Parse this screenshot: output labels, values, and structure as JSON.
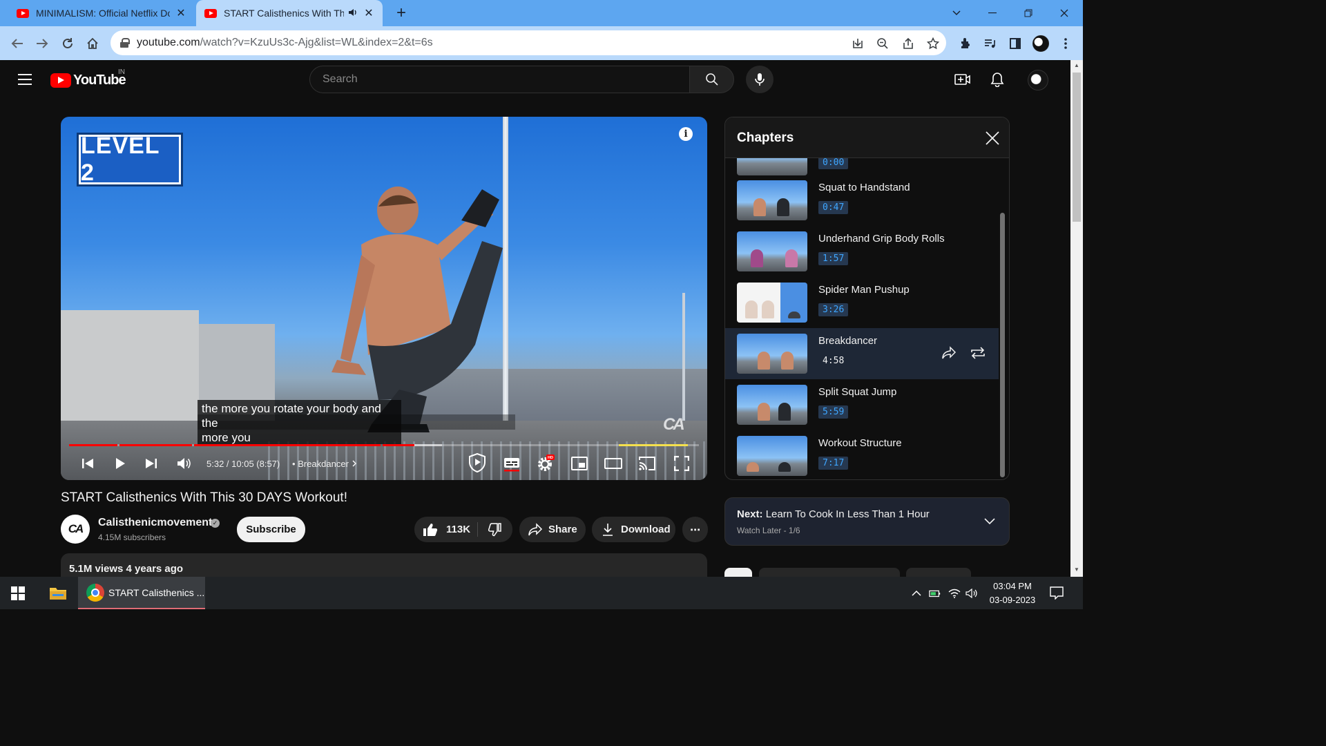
{
  "browser": {
    "tabs": [
      {
        "title": "MINIMALISM: Official Netflix Do",
        "close": "✕"
      },
      {
        "title": "START Calisthenics With This",
        "close": "✕"
      }
    ],
    "new_tab": "+",
    "url_domain": "youtube.com",
    "url_path": "/watch?v=KzuUs3c-Ajg&list=WL&index=2&t=6s"
  },
  "youtube": {
    "logo_text": "YouTube",
    "country_code": "IN",
    "search_placeholder": "Search"
  },
  "player": {
    "overlay_badge": "LEVEL 2",
    "caption_line1": "the more you rotate your body and the",
    "caption_line2": "more you",
    "watermark": "CA",
    "time_display": "5:32 / 10:05 (8:57)",
    "separator": "•",
    "chapter_name": "Breakdancer",
    "progress_fraction": 0.55,
    "hd_badge": "HD"
  },
  "chapters": {
    "heading": "Chapters",
    "partial_time": "0:00",
    "items": [
      {
        "title": "Squat to Handstand",
        "time": "0:47",
        "active": false
      },
      {
        "title": "Underhand Grip Body Rolls",
        "time": "1:57",
        "active": false
      },
      {
        "title": "Spider Man Pushup",
        "time": "3:26",
        "active": false
      },
      {
        "title": "Breakdancer",
        "time": "4:58",
        "active": true
      },
      {
        "title": "Split Squat Jump",
        "time": "5:59",
        "active": false
      },
      {
        "title": "Workout Structure",
        "time": "7:17",
        "active": false
      }
    ]
  },
  "video": {
    "title": "START Calisthenics With This 30 DAYS Workout!",
    "channel_avatar_text": "CA",
    "channel_name": "Calisthenicmovement",
    "verified_mark": "✓",
    "subscribers": "4.15M subscribers",
    "subscribe_label": "Subscribe",
    "likes": "113K",
    "share_label": "Share",
    "download_label": "Download",
    "more_label": "⋯",
    "stats": "5.1M views  4 years ago"
  },
  "next_up": {
    "label": "Next:",
    "title": "Learn To Cook In Less Than 1 Hour",
    "playlist": "Watch Later - 1/6"
  },
  "taskbar": {
    "chrome_window_title": "START Calisthenics ...",
    "time": "03:04 PM",
    "date": "03-09-2023"
  },
  "colors": {
    "youtube_red": "#ff0000",
    "progress_red": "#ff0000",
    "chapter_time_blue": "#3ea6ff",
    "browser_tabstrip": "#5da6f0"
  }
}
